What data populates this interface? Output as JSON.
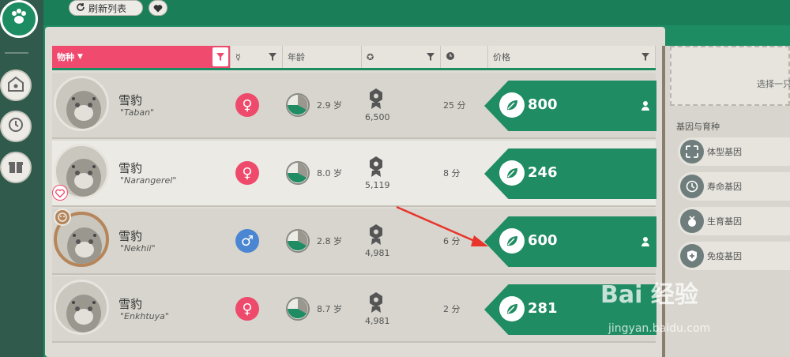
{
  "toolbar": {
    "refresh_label": "刷新列表"
  },
  "table": {
    "headers": {
      "species": "物种",
      "age": "年龄",
      "price": "价格"
    },
    "rows": [
      {
        "name": "雪豹",
        "nick": "\"Taban\"",
        "sex": "f",
        "sex_symbol": "♀",
        "age": "2.9 岁",
        "award": "6,500",
        "time": "25 分",
        "price": "800",
        "badge": "none",
        "user_icon": true
      },
      {
        "name": "雪豹",
        "nick": "\"Narangerel\"",
        "sex": "f",
        "sex_symbol": "♀",
        "age": "8.0 岁",
        "award": "5,119",
        "time": "8 分",
        "price": "246",
        "badge": "heart",
        "user_icon": false
      },
      {
        "name": "雪豹",
        "nick": "\"Nekhii\"",
        "sex": "m",
        "sex_symbol": "♂",
        "age": "2.8 岁",
        "award": "4,981",
        "time": "6 分",
        "price": "600",
        "badge": "ring",
        "user_icon": true
      },
      {
        "name": "雪豹",
        "nick": "\"Enkhtuya\"",
        "sex": "f",
        "sex_symbol": "♀",
        "age": "8.7 岁",
        "award": "4,981",
        "time": "2 分",
        "price": "281",
        "badge": "none",
        "user_icon": false
      }
    ]
  },
  "right": {
    "select_text": "选择一只",
    "gene_title": "基因与育种",
    "genes": [
      {
        "label": "体型基因",
        "icon": "expand-icon"
      },
      {
        "label": "寿命基因",
        "icon": "clock-icon"
      },
      {
        "label": "生育基因",
        "icon": "fertility-icon"
      },
      {
        "label": "免疫基因",
        "icon": "shield-icon"
      }
    ]
  },
  "watermark": {
    "brand": "Bai 经验",
    "url": "jingyan.baidu.com"
  },
  "colors": {
    "accent_green": "#1f8c63",
    "female": "#ee4a6c",
    "male": "#4a86d2",
    "species_header": "#f04a6e"
  }
}
